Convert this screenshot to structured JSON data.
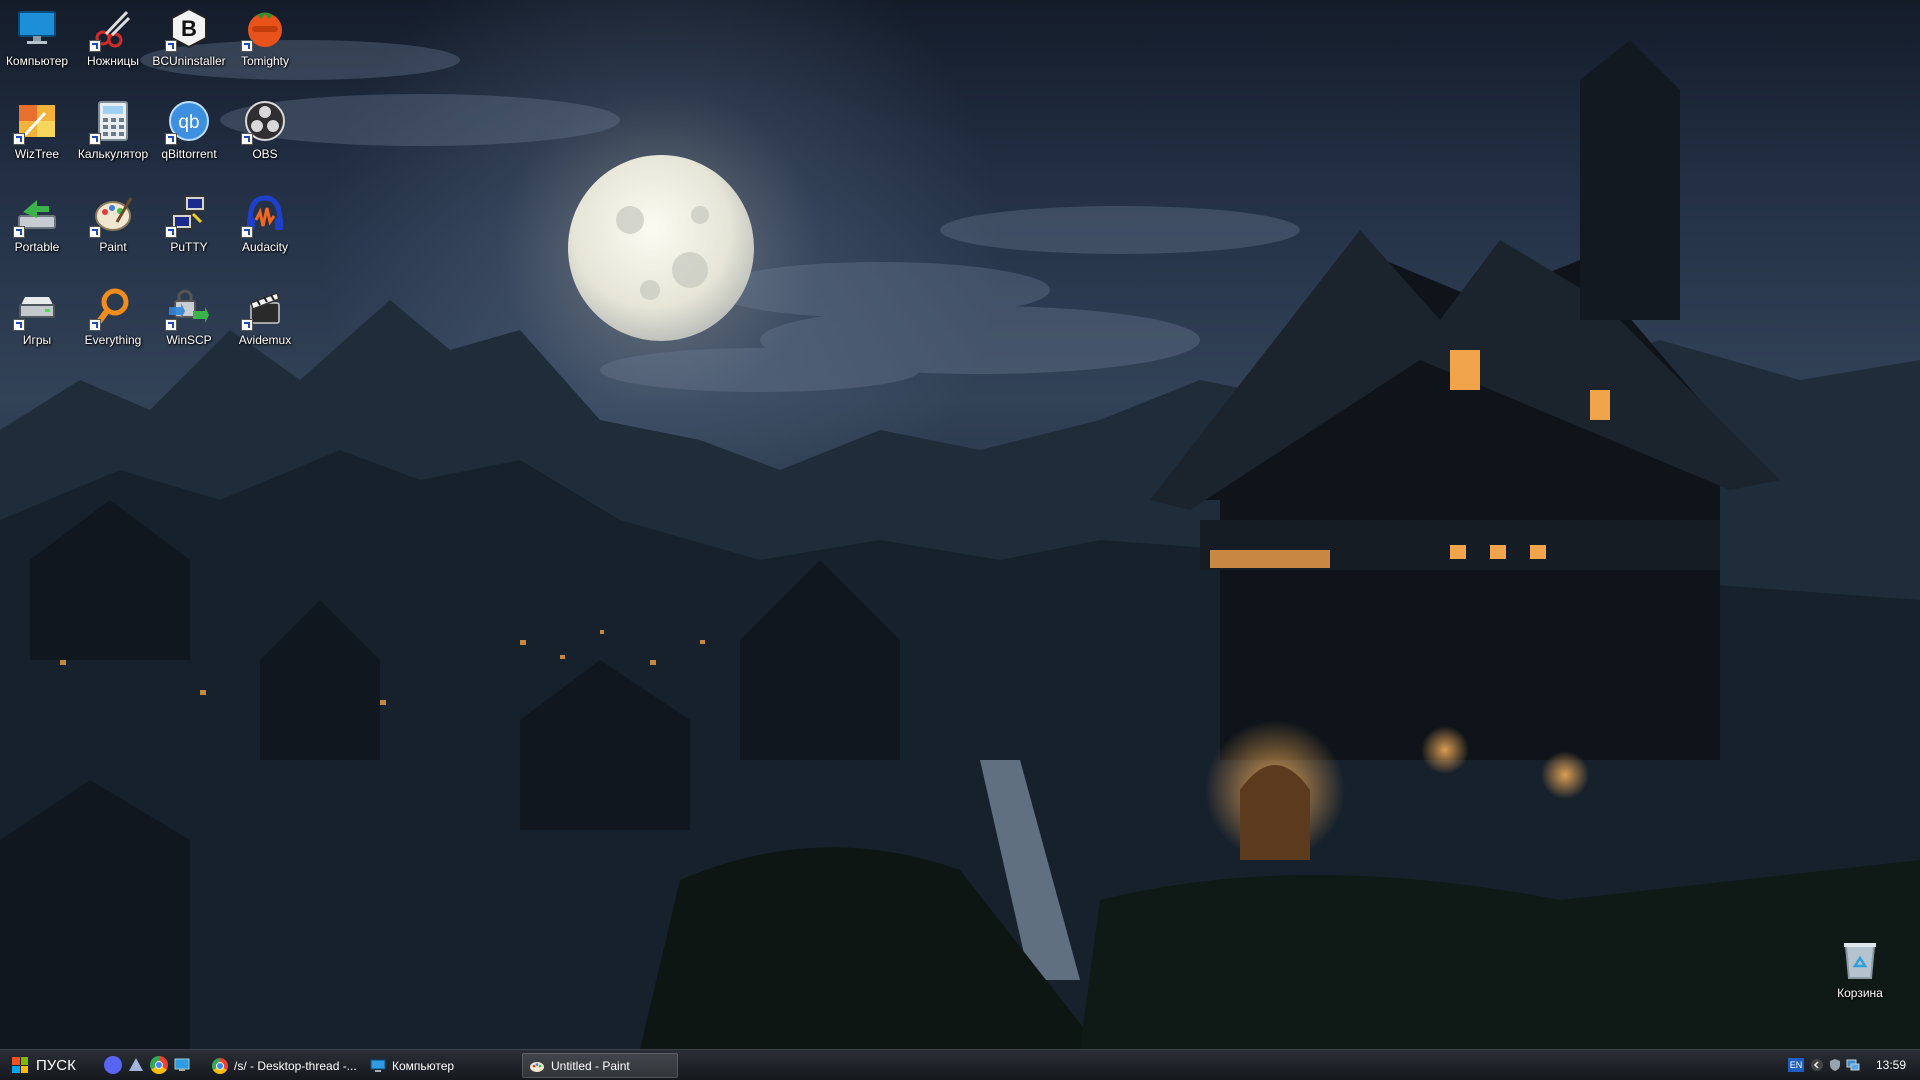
{
  "desktop": {
    "icons": [
      {
        "label": "Компьютер",
        "icon": "monitor-icon"
      },
      {
        "label": "Ножницы",
        "icon": "scissors-icon"
      },
      {
        "label": "BCUninstaller",
        "icon": "bcuninstaller-icon"
      },
      {
        "label": "Tomighty",
        "icon": "tomato-timer-icon"
      },
      {
        "label": "WizTree",
        "icon": "wiztree-icon"
      },
      {
        "label": "Калькулятор",
        "icon": "calculator-icon"
      },
      {
        "label": "qBittorrent",
        "icon": "qbittorrent-icon"
      },
      {
        "label": "OBS",
        "icon": "obs-icon"
      },
      {
        "label": "Portable",
        "icon": "portable-drive-icon"
      },
      {
        "label": "Paint",
        "icon": "paint-palette-icon"
      },
      {
        "label": "PuTTY",
        "icon": "putty-icon"
      },
      {
        "label": "Audacity",
        "icon": "audacity-icon"
      },
      {
        "label": "Игры",
        "icon": "games-drive-icon"
      },
      {
        "label": "Everything",
        "icon": "everything-search-icon"
      },
      {
        "label": "WinSCP",
        "icon": "winscp-icon"
      },
      {
        "label": "Avidemux",
        "icon": "avidemux-clapper-icon"
      }
    ],
    "recycle_bin": {
      "label": "Корзина",
      "icon": "recycle-bin-icon"
    }
  },
  "taskbar": {
    "start_label": "ПУСК",
    "quick_launch": [
      "discord-icon",
      "launcher-icon",
      "chrome-icon",
      "desktop-icon"
    ],
    "tasks": [
      {
        "title": "/s/ - Desktop-thread -...",
        "icon": "chrome-icon"
      },
      {
        "title": "Компьютер",
        "icon": "monitor-icon"
      },
      {
        "title": "Untitled - Paint",
        "icon": "paint-palette-icon"
      }
    ],
    "tray": {
      "language": "EN",
      "icons": [
        "chevron-left-icon",
        "shield-icon",
        "network-icon"
      ],
      "clock": "13:59"
    }
  },
  "colors": {
    "taskbar_bg": "#1b1e24",
    "moon": "#e9e8de",
    "sky": "#26344a",
    "window_glow": "#f3a34a"
  }
}
